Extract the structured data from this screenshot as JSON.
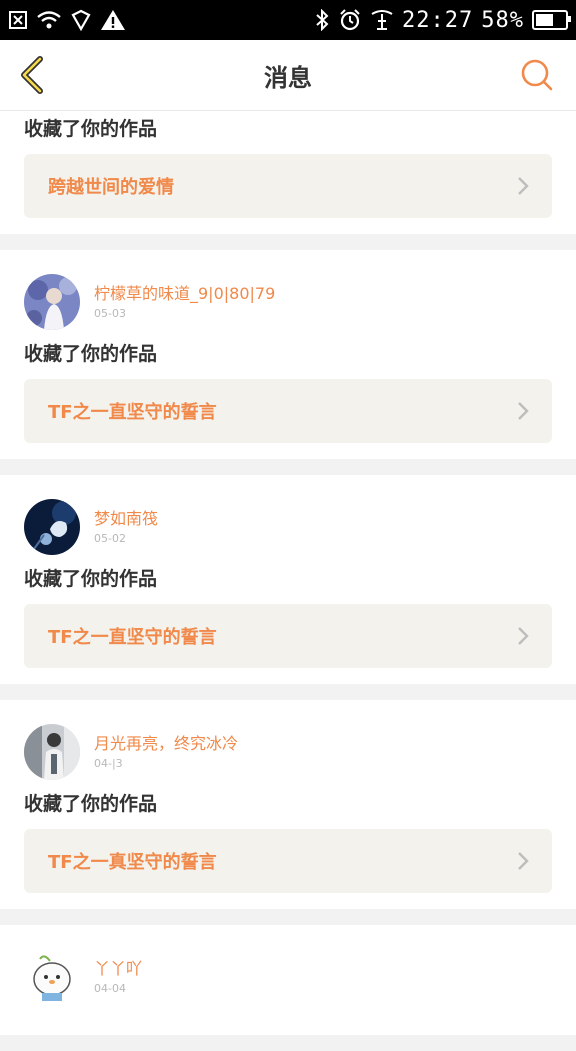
{
  "status_bar": {
    "time": "22:27",
    "battery": "58%",
    "left_icons": [
      "notification-close-icon",
      "wifi-icon",
      "vpn-shield-icon",
      "warning-icon"
    ],
    "right_icons": [
      "bluetooth-icon",
      "alarm-icon",
      "signal-icon"
    ]
  },
  "navbar": {
    "title": "消息",
    "back_icon": "chevron-left-icon",
    "search_icon": "search-icon",
    "accent_color": "#f0894a"
  },
  "messages": [
    {
      "action": "收藏了你的作品",
      "work_title": "跨越世间的爱情"
    },
    {
      "user_name": "柠檬草的味道_9|0|80|79",
      "date": "05-03",
      "action": "收藏了你的作品",
      "work_title": "TF之一直坚守的誓言"
    },
    {
      "user_name": "梦如南筏",
      "date": "05-02",
      "action": "收藏了你的作品",
      "work_title": "TF之一直坚守的誓言"
    },
    {
      "user_name": "月光再亮，终究冰冷",
      "date": "04-|3",
      "action": "收藏了你的作品",
      "work_title": "TF之一真坚守的誓言"
    },
    {
      "user_name": "丫丫吖",
      "date": "04-04"
    }
  ]
}
